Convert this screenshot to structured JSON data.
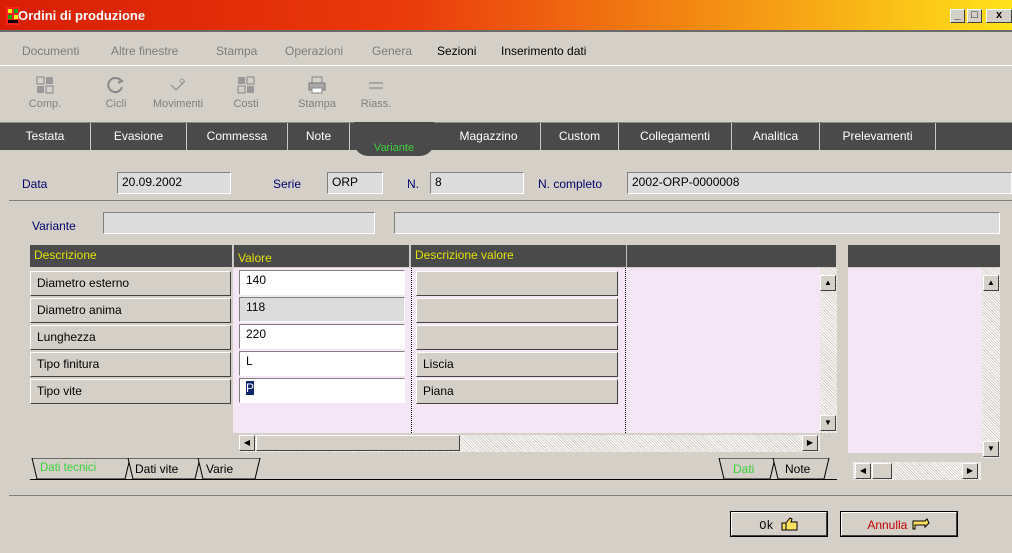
{
  "window": {
    "title": "Ordini di produzione",
    "min": "_",
    "max": "□",
    "close": "x"
  },
  "menu": [
    {
      "label": "Documenti",
      "enabled": false
    },
    {
      "label": "Altre finestre",
      "enabled": false
    },
    {
      "label": "Stampa",
      "enabled": false
    },
    {
      "label": "Operazioni",
      "enabled": false
    },
    {
      "label": "Genera",
      "enabled": false
    },
    {
      "label": "Sezioni",
      "enabled": true
    },
    {
      "label": "Inserimento dati",
      "enabled": true
    }
  ],
  "toolbar": [
    {
      "label": "Comp.",
      "icon": "components-icon"
    },
    {
      "label": "Cicli",
      "icon": "cycle-icon"
    },
    {
      "label": "Movimenti",
      "icon": "movements-icon"
    },
    {
      "label": "Costi",
      "icon": "costs-icon"
    },
    {
      "label": "Stampa",
      "icon": "printer-icon"
    },
    {
      "label": "Riass.",
      "icon": "summary-icon"
    }
  ],
  "tabs": [
    "Testata",
    "Evasione",
    "Commessa",
    "Note",
    "Magazzino",
    "Custom",
    "Collegamenti",
    "Analitica",
    "Prelevamenti"
  ],
  "active_tab": "Variante",
  "header": {
    "data_label": "Data",
    "data_value": "20.09.2002",
    "serie_label": "Serie",
    "serie_value": "ORP",
    "n_label": "N.",
    "n_value": "8",
    "ncompleto_label": "N. completo",
    "ncompleto_value": "2002-ORP-0000008"
  },
  "variante": {
    "label": "Variante",
    "value": "",
    "desc": ""
  },
  "grid": {
    "columns": [
      "Descrizione",
      "Valore",
      "Descrizione valore"
    ],
    "rows": [
      {
        "descrizione": "Diametro esterno",
        "valore": "140",
        "descrizione_valore": "",
        "editable": true
      },
      {
        "descrizione": "Diametro anima",
        "valore": "118",
        "descrizione_valore": "",
        "editable": false
      },
      {
        "descrizione": "Lunghezza",
        "valore": "220",
        "descrizione_valore": "",
        "editable": true
      },
      {
        "descrizione": "Tipo finitura",
        "valore": "L",
        "descrizione_valore": "Liscia",
        "editable": true
      },
      {
        "descrizione": "Tipo vite",
        "valore": "P",
        "descrizione_valore": "Piana",
        "editable": true
      }
    ]
  },
  "left_tabs": [
    "Dati tecnici",
    "Dati vite",
    "Varie"
  ],
  "right_tabs": [
    "Dati",
    "Note"
  ],
  "buttons": {
    "ok": "Ok",
    "annulla": "Annulla"
  },
  "colors": {
    "accent_green": "#3bd13b",
    "header_yellow": "#e0e000",
    "dark_gray": "#4a4a4a",
    "pink": "#f5e6f5"
  }
}
